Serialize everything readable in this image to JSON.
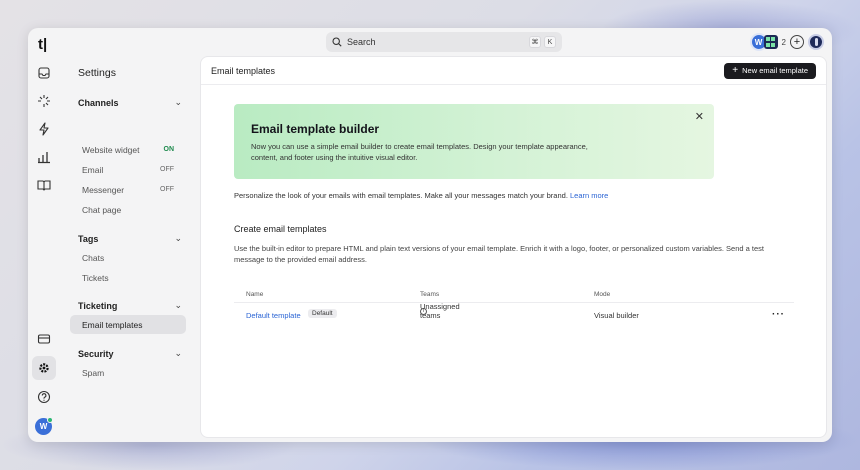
{
  "app": {
    "logo": "t|"
  },
  "search": {
    "placeholder": "Search",
    "shortcut_keys": [
      "⌘",
      "K"
    ]
  },
  "topbar": {
    "workspace_initial": "W",
    "notification_count": "2"
  },
  "rail": {
    "icons": [
      "inbox-icon",
      "sparkle-icon",
      "bolt-icon",
      "chart-icon",
      "book-icon",
      "billing-icon",
      "settings-icon",
      "help-icon"
    ],
    "avatar_initial": "W",
    "status_color": "#2bb673"
  },
  "settings": {
    "title": "Settings",
    "sections": [
      {
        "label": "Channels",
        "items": [
          {
            "label": "Website widget",
            "status": "ON"
          },
          {
            "label": "Email",
            "status": "OFF"
          },
          {
            "label": "Messenger",
            "status": "OFF"
          },
          {
            "label": "Chat page",
            "status": ""
          }
        ]
      },
      {
        "label": "Tags",
        "items": [
          {
            "label": "Chats"
          },
          {
            "label": "Tickets"
          }
        ]
      },
      {
        "label": "Ticketing",
        "items": [
          {
            "label": "Email templates",
            "selected": true
          }
        ]
      },
      {
        "label": "Security",
        "items": [
          {
            "label": "Spam"
          }
        ]
      }
    ]
  },
  "main": {
    "title": "Email templates",
    "new_button": "New email template",
    "banner": {
      "title": "Email template builder",
      "text": "Now you can use a simple email builder to create email templates. Design your template appearance, content, and footer using the intuitive visual editor."
    },
    "intro_text": "Personalize the look of your emails with email templates. Make all your messages match your brand.",
    "learn_more": "Learn more",
    "section_title": "Create email templates",
    "section_desc": "Use the built-in editor to prepare HTML and plain text versions of your email template. Enrich it with a logo, footer, or personalized custom variables. Send a test message to the provided email address.",
    "table": {
      "headers": {
        "name": "Name",
        "teams": "Teams",
        "mode": "Mode"
      },
      "rows": [
        {
          "name": "Default template",
          "badge": "Default",
          "teams": "Unassigned teams",
          "mode": "Visual builder"
        }
      ]
    }
  },
  "colors": {
    "accent_link": "#2a64d4",
    "on_status": "#1e8a4d",
    "banner_green": "#b9ebc2",
    "button_dark": "#1b1b1f"
  }
}
